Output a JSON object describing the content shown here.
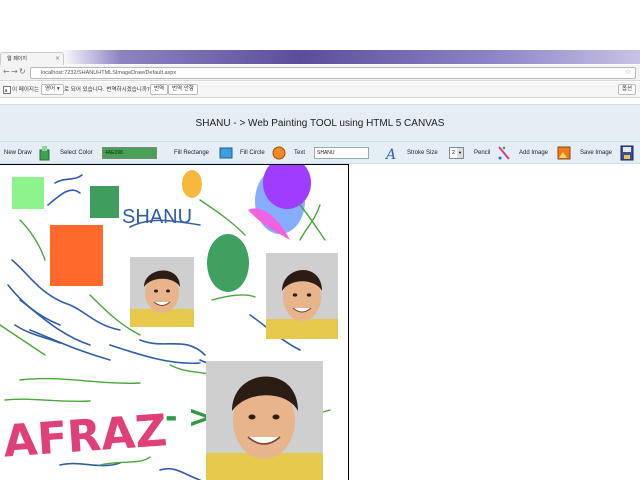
{
  "browser": {
    "tab_title": "웹 페이지",
    "url": "localhost:7232/SHANUHTMLSImageDraw/Default.aspx",
    "translate_bar": {
      "prefix": "이 페이지는",
      "language": "영어",
      "suffix": "로 되어 있습니다. 번역하시겠습니까?",
      "translate_button": "번역",
      "never_button": "번역 안함",
      "options_button": "옵션"
    }
  },
  "page": {
    "title": "SHANU - > Web Painting TOOL using HTML 5 CANVAS"
  },
  "toolbar": {
    "new_draw": "New Draw",
    "select_color": "Select Color",
    "color_value": "4AE098",
    "fill_rectangle": "Fill Rectange",
    "fill_circle": "Fill Circle",
    "text": "Text",
    "text_value": "SHANU",
    "stroke_size": "Stroke Size",
    "stroke_value": "2",
    "pencil": "Pencil",
    "add_image": "Add Image",
    "save_image": "Save Image"
  },
  "canvas": {
    "shanu_text": "SHANU",
    "afraz_text": "AFRAZ",
    "arrow_text": "- >"
  },
  "colors": {
    "header_bg": "#e5eef5",
    "orange_rect": "#ff6a2c",
    "green_rect": "#3f9d5e",
    "light_green": "#8df48d",
    "pink_text": "#e0407a",
    "blue_stroke": "#2f5ea6",
    "purple_circle": "#9f3cff"
  }
}
